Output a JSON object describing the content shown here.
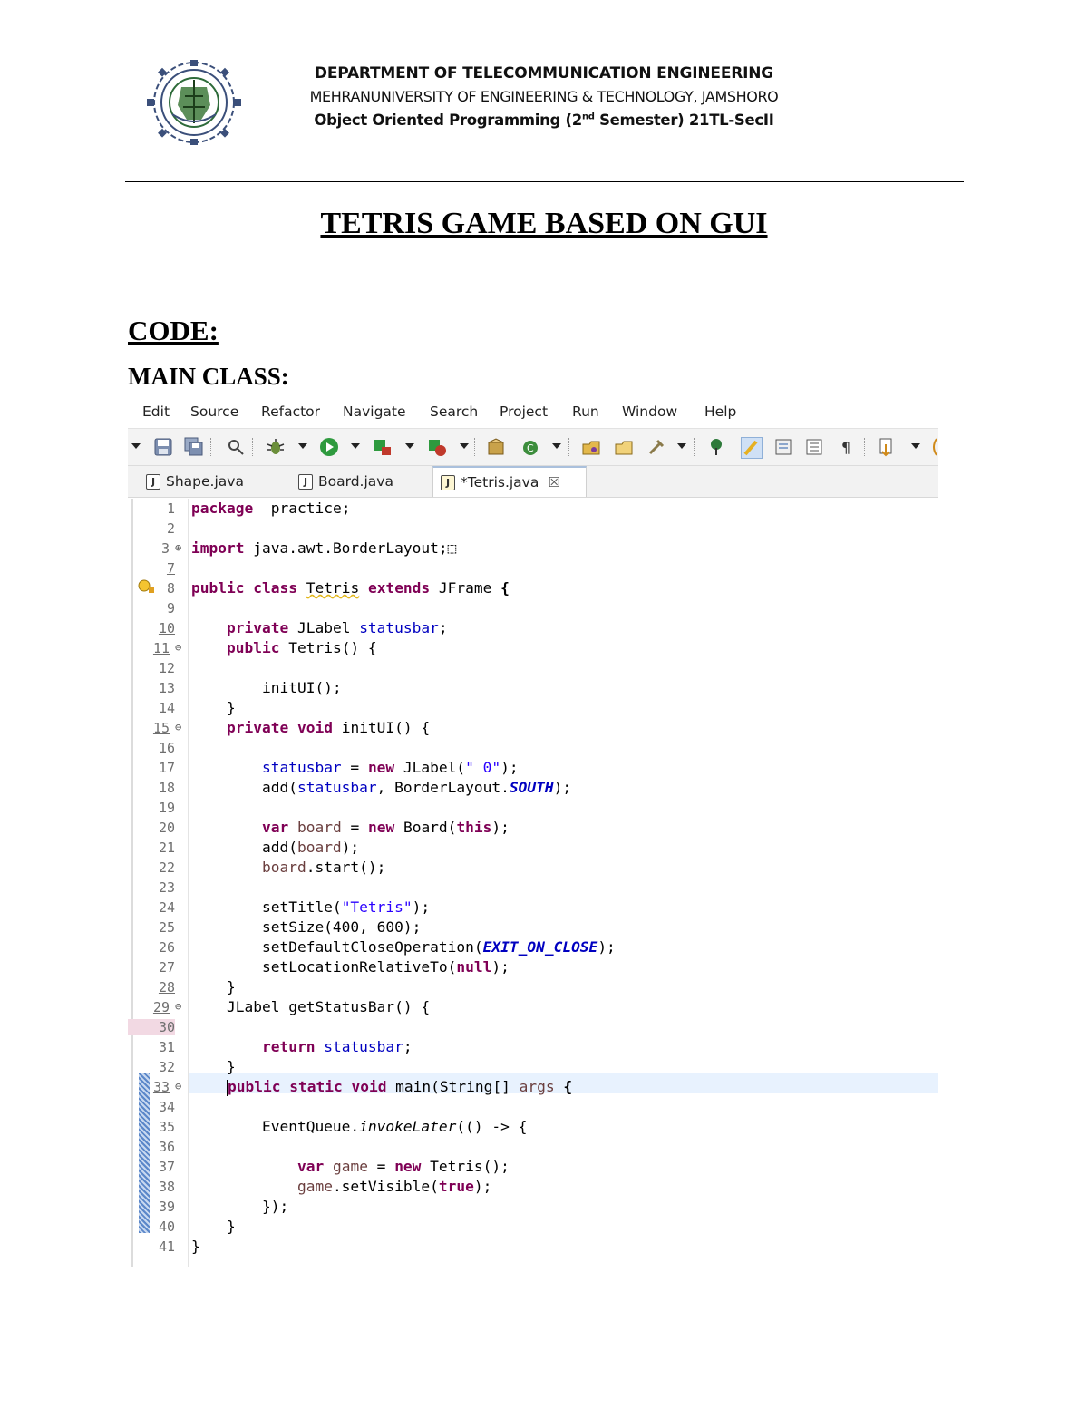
{
  "header": {
    "line1": "DEPARTMENT OF TELECOMMUNICATION ENGINEERING",
    "line2": "MEHRANUNIVERSITY OF ENGINEERING & TECHNOLOGY, JAMSHORO",
    "line3_pre": "Object Oriented Programming (2",
    "line3_sup": "nd",
    "line3_post": " Semester) 21TL-SecII"
  },
  "title": "TETRIS GAME BASED ON GUI",
  "section_heading": "CODE:",
  "subheading": "MAIN CLASS:",
  "ide": {
    "menu": [
      "Edit",
      "Source",
      "Refactor",
      "Navigate",
      "Search",
      "Project",
      "Run",
      "Window",
      "Help"
    ],
    "tabs": [
      {
        "label": "Shape.java",
        "active": false
      },
      {
        "label": "Board.java",
        "active": false
      },
      {
        "label": "*Tetris.java",
        "active": true
      }
    ],
    "tab_close_glyph": "☒",
    "line_numbers": [
      "1",
      "2",
      "3",
      "7",
      "8",
      "9",
      "10",
      "11",
      "12",
      "13",
      "14",
      "15",
      "16",
      "17",
      "18",
      "19",
      "20",
      "21",
      "22",
      "23",
      "24",
      "25",
      "26",
      "27",
      "28",
      "29",
      "30",
      "31",
      "32",
      "33",
      "34",
      "35",
      "36",
      "37",
      "38",
      "39",
      "40",
      "41"
    ]
  }
}
